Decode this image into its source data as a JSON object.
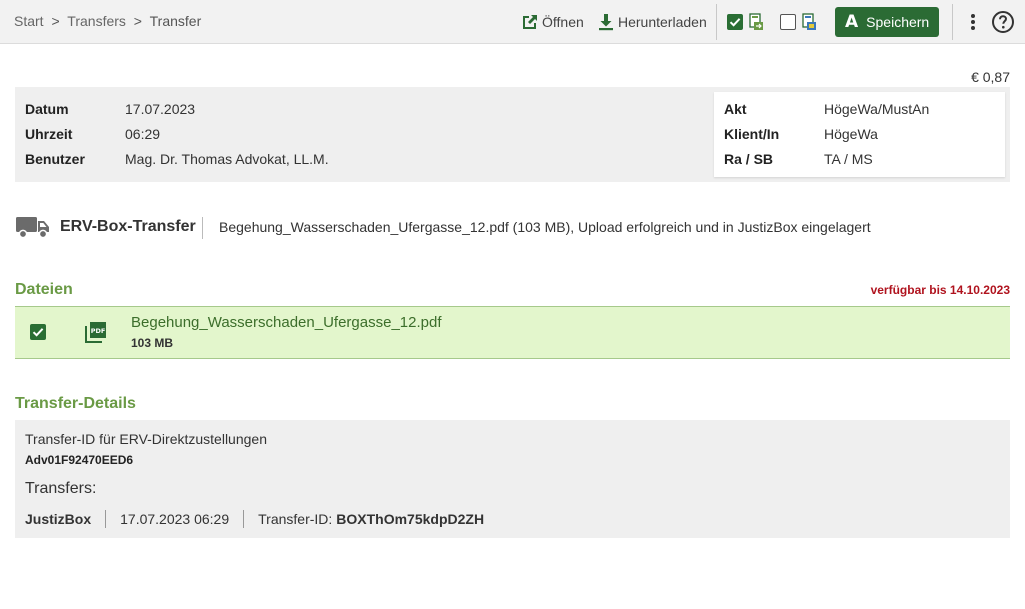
{
  "breadcrumb": {
    "items": [
      "Start",
      "Transfers",
      "Transfer"
    ],
    "separator": ">"
  },
  "toolbar": {
    "open_label": "Öffnen",
    "download_label": "Herunterladen",
    "save_label": "Speichern",
    "save_logo": "A",
    "checkbox_1_checked": true,
    "checkbox_2_checked": false
  },
  "amount": "€ 0,87",
  "info": {
    "left": [
      {
        "label": "Datum",
        "value": "17.07.2023"
      },
      {
        "label": "Uhrzeit",
        "value": "06:29"
      },
      {
        "label": "Benutzer",
        "value": "Mag. Dr. Thomas Advokat, LL.M."
      }
    ],
    "right": [
      {
        "label": "Akt",
        "value": "HögeWa/MustAn"
      },
      {
        "label": "Klient/In",
        "value": "HögeWa"
      },
      {
        "label": "Ra / SB",
        "value": "TA / MS"
      }
    ]
  },
  "transfer": {
    "title": "ERV-Box-Transfer",
    "description": "Begehung_Wasserschaden_Ufergasse_12.pdf (103 MB), Upload erfolgreich und in JustizBox eingelagert"
  },
  "files": {
    "title": "Dateien",
    "available_until": "verfügbar bis 14.10.2023",
    "items": [
      {
        "name": "Begehung_Wasserschaden_Ufergasse_12.pdf",
        "size": "103 MB",
        "checked": true,
        "icon_text": "PDF"
      }
    ]
  },
  "details": {
    "title": "Transfer-Details",
    "id_label": "Transfer-ID für ERV-Direktzustellungen",
    "id_value": "Adv01F92470EED6",
    "transfers_label": "Transfers:",
    "transfers": [
      {
        "target": "JustizBox",
        "datetime": "17.07.2023 06:29",
        "id_label": "Transfer-ID:",
        "id_value": "BOXThOm75kdpD2ZH"
      }
    ]
  },
  "colors": {
    "accent_green": "#2b6b34",
    "section_green": "#6a9a45",
    "file_row_bg": "#e3f6cc",
    "warning_red": "#b0131e"
  }
}
